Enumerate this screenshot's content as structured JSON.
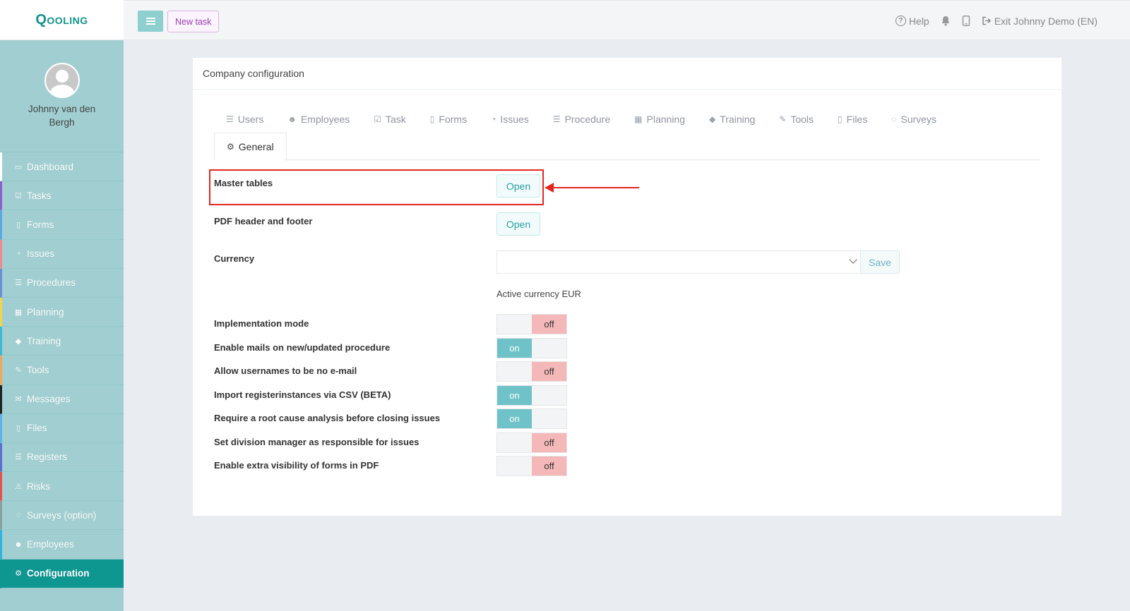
{
  "brand": {
    "logo_text": "Qooling",
    "accent": "#0e9691"
  },
  "user": {
    "name": "Johnny van den Bergh"
  },
  "sidebar": {
    "items": [
      {
        "label": "Dashboard",
        "icon": "monitor-icon",
        "stripe": "#ffffff"
      },
      {
        "label": "Tasks",
        "icon": "check-square-icon",
        "stripe": "#8e5fd0"
      },
      {
        "label": "Forms",
        "icon": "file-icon",
        "stripe": "#5aa9e6"
      },
      {
        "label": "Issues",
        "icon": "bell-icon",
        "stripe": "#f08a8a"
      },
      {
        "label": "Procedures",
        "icon": "list-icon",
        "stripe": "#6a8fd8"
      },
      {
        "label": "Planning",
        "icon": "calendar-icon",
        "stripe": "#f3d34a"
      },
      {
        "label": "Training",
        "icon": "graduation-cap-icon",
        "stripe": "#3fb5d9"
      },
      {
        "label": "Tools",
        "icon": "wrench-icon",
        "stripe": "#f0a85a"
      },
      {
        "label": "Messages",
        "icon": "envelope-icon",
        "stripe": "#222222"
      },
      {
        "label": "Files",
        "icon": "file-icon",
        "stripe": "#5db3e8"
      },
      {
        "label": "Registers",
        "icon": "list-icon",
        "stripe": "#5a6fd0"
      },
      {
        "label": "Risks",
        "icon": "warning-icon",
        "stripe": "#e8504a"
      },
      {
        "label": "Surveys (option)",
        "icon": "comment-icon",
        "stripe": "#8aa0a0"
      },
      {
        "label": "Employees",
        "icon": "users-icon",
        "stripe": "#2db4e0"
      },
      {
        "label": "Configuration",
        "icon": "gear-icon",
        "stripe": "#0e9691",
        "active": true
      }
    ]
  },
  "topbar": {
    "new_task_label": "New task",
    "help_label": "Help",
    "exit_label": "Exit Johnny Demo (EN)"
  },
  "card": {
    "title": "Company configuration",
    "tabs": [
      {
        "label": "Users",
        "icon": "list-icon"
      },
      {
        "label": "Employees",
        "icon": "users-icon"
      },
      {
        "label": "Task",
        "icon": "check-square-icon"
      },
      {
        "label": "Forms",
        "icon": "file-icon"
      },
      {
        "label": "Issues",
        "icon": "bell-icon"
      },
      {
        "label": "Procedure",
        "icon": "list-icon"
      },
      {
        "label": "Planning",
        "icon": "calendar-icon"
      },
      {
        "label": "Training",
        "icon": "graduation-cap-icon"
      },
      {
        "label": "Tools",
        "icon": "wrench-icon"
      },
      {
        "label": "Files",
        "icon": "file-icon"
      },
      {
        "label": "Surveys",
        "icon": "comment-icon"
      }
    ],
    "active_tab": {
      "label": "General",
      "icon": "gear-icon"
    }
  },
  "settings": {
    "master_tables": {
      "label": "Master tables",
      "button": "Open"
    },
    "pdf_header_footer": {
      "label": "PDF header and footer",
      "button": "Open"
    },
    "currency": {
      "label": "Currency",
      "value": "",
      "save_label": "Save",
      "active_text": "Active currency EUR"
    },
    "toggles": [
      {
        "label": "Implementation mode",
        "state": "off"
      },
      {
        "label": "Enable mails on new/updated procedure",
        "state": "on"
      },
      {
        "label": "Allow usernames to be no e-mail",
        "state": "off"
      },
      {
        "label": "Import registerinstances via CSV (BETA)",
        "state": "on"
      },
      {
        "label": "Require a root cause analysis before closing issues",
        "state": "on"
      },
      {
        "label": "Set division manager as responsible for issues",
        "state": "off"
      },
      {
        "label": "Enable extra visibility of forms in PDF",
        "state": "off"
      }
    ],
    "on_label": "on",
    "off_label": "off"
  },
  "annotation": {
    "color": "#e3261f"
  }
}
